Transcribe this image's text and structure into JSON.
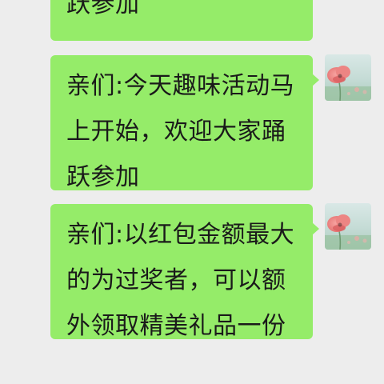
{
  "messages": [
    {
      "lines": [
        "跃参加"
      ],
      "sender": "self",
      "avatar_icon": "flower-photo-avatar",
      "avatar_visible": false
    },
    {
      "lines": [
        "亲们:今天趣味活动马",
        "上开始，欢迎大家踊",
        "跃参加"
      ],
      "sender": "self",
      "avatar_icon": "flower-photo-avatar",
      "avatar_visible": true
    },
    {
      "lines": [
        "亲们:以红包金额最大",
        "的为过奖者，可以额",
        "外领取精美礼品一份"
      ],
      "sender": "self",
      "avatar_icon": "flower-photo-avatar",
      "avatar_visible": true
    }
  ],
  "colors": {
    "background": "#ededed",
    "bubble": "#95ec69",
    "text": "#1a1a1a"
  }
}
